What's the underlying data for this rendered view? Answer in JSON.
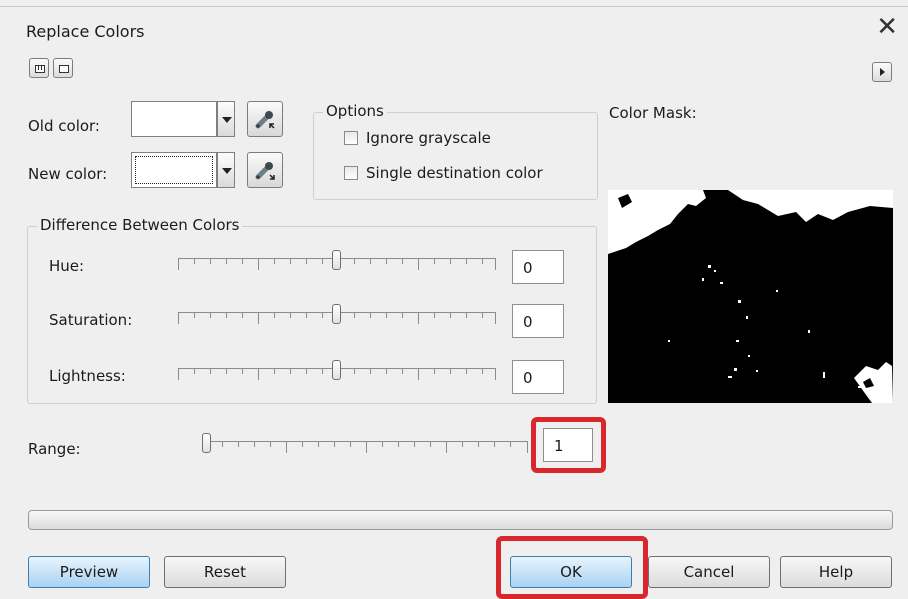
{
  "window": {
    "title": "Replace Colors"
  },
  "labels": {
    "old_color": "Old color:",
    "new_color": "New color:",
    "options": "Options",
    "ignore_grayscale": "Ignore grayscale",
    "single_destination": "Single destination color",
    "color_mask": "Color Mask:",
    "difference_group": "Difference Between Colors",
    "hue": "Hue:",
    "saturation": "Saturation:",
    "lightness": "Lightness:",
    "range": "Range:"
  },
  "values": {
    "hue": "0",
    "saturation": "0",
    "lightness": "0",
    "range": "1"
  },
  "buttons": {
    "preview": "Preview",
    "reset": "Reset",
    "ok": "OK",
    "cancel": "Cancel",
    "help": "Help"
  },
  "checkboxes": {
    "ignore_grayscale": false,
    "single_destination": false
  },
  "colors": {
    "highlight": "#d8282c",
    "accent": "#3c7fb1"
  },
  "icons": {
    "close": "close-icon",
    "view_split": "split-view-icon",
    "view_single": "single-view-icon",
    "expand": "expand-arrow-icon",
    "eyedropper": "eyedropper-icon"
  }
}
